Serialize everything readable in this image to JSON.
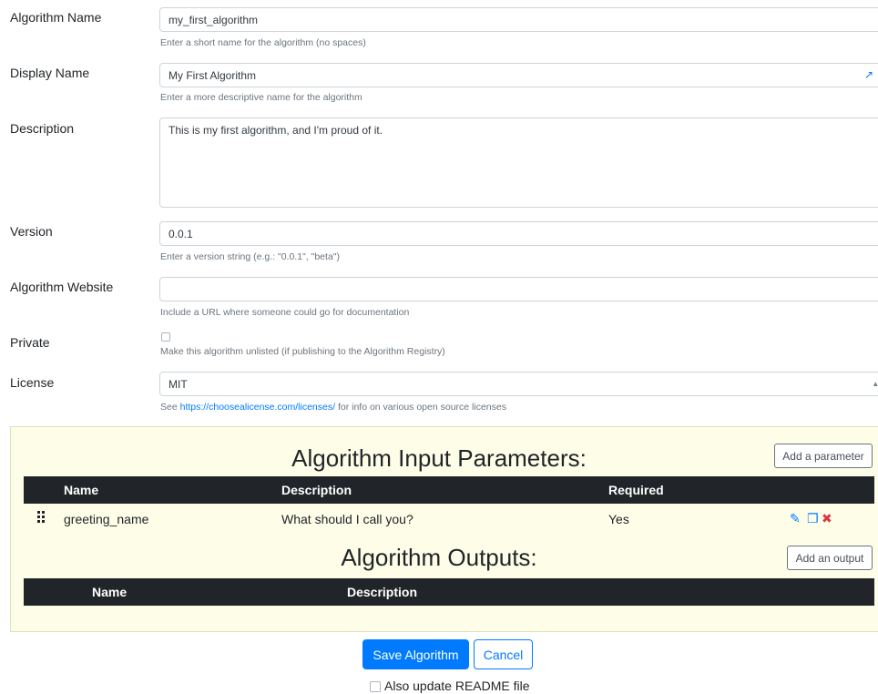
{
  "form": {
    "algorithm_name": {
      "label": "Algorithm Name",
      "value": "my_first_algorithm",
      "help": "Enter a short name for the algorithm (no spaces)"
    },
    "display_name": {
      "label": "Display Name",
      "value": "My First Algorithm",
      "help": "Enter a more descriptive name for the algorithm"
    },
    "description": {
      "label": "Description",
      "value": "This is my first algorithm, and I'm proud of it."
    },
    "version": {
      "label": "Version",
      "value": "0.0.1",
      "help": "Enter a version string (e.g.: \"0.0.1\", \"beta\")"
    },
    "website": {
      "label": "Algorithm Website",
      "value": "",
      "help": "Include a URL where someone could go for documentation"
    },
    "private": {
      "label": "Private",
      "checked": false,
      "help": "Make this algorithm unlisted (if publishing to the Algorithm Registry)"
    },
    "license": {
      "label": "License",
      "value": "MIT",
      "help_prefix": "See ",
      "help_link": "https://choosealicense.com/licenses/",
      "help_suffix": " for info on various open source licenses"
    }
  },
  "inputs": {
    "title": "Algorithm Input Parameters:",
    "add_button": "Add a parameter",
    "columns": [
      "Name",
      "Description",
      "Required"
    ],
    "rows": [
      {
        "name": "greeting_name",
        "description": "What should I call you?",
        "required": "Yes"
      }
    ]
  },
  "outputs": {
    "title": "Algorithm Outputs:",
    "add_button": "Add an output",
    "columns": [
      "Name",
      "Description"
    ]
  },
  "actions": {
    "save": "Save Algorithm",
    "cancel": "Cancel",
    "readme_label": "Also update README file"
  },
  "icons": {
    "edit": "edit-icon",
    "copy": "copy-icon",
    "delete": "trash-icon",
    "drag": "grip-icon",
    "pin": "pin-icon"
  },
  "colors": {
    "primary": "#007bff",
    "danger": "#dc3545",
    "panel_bg": "#fefee8",
    "table_header": "#212529"
  }
}
